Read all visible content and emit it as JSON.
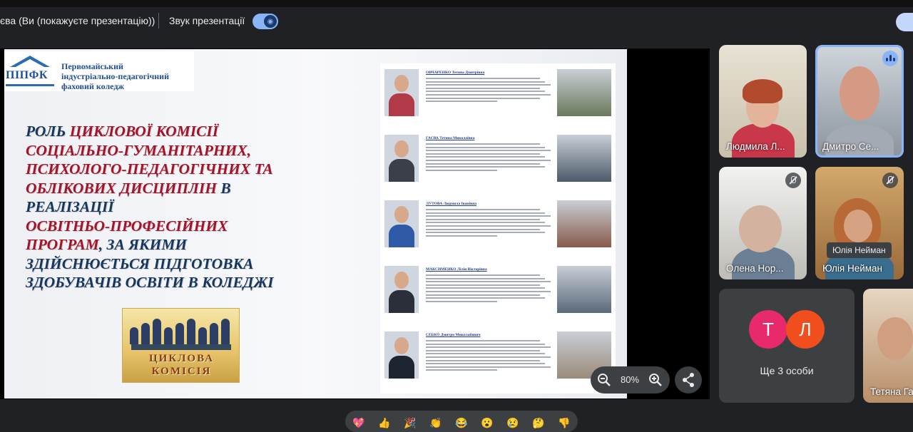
{
  "header": {
    "presenting_label": "єва (Ви (покажуєте презентацію))",
    "sound_label": "Звук презентації",
    "sound_on": true
  },
  "slide": {
    "logo_abbr": "ПІПФК",
    "logo_lines": [
      "Первомайський",
      "індустріально-педагогічний",
      "фаховий коледж"
    ],
    "title_lines": [
      [
        {
          "t": "Роль ",
          "red": false
        },
        {
          "t": "циклової комісії",
          "red": true
        }
      ],
      [
        {
          "t": "соціально-гуманітарних,",
          "red": true
        }
      ],
      [
        {
          "t": "психолого-педагогічних та",
          "red": true
        }
      ],
      [
        {
          "t": "облікових дисциплін",
          "red": true
        },
        {
          "t": " в",
          "red": false
        }
      ],
      [
        {
          "t": "реалізації",
          "red": false
        }
      ],
      [
        {
          "t": "освітньо-професійних",
          "red": true
        }
      ],
      [
        {
          "t": "програм",
          "red": true
        },
        {
          "t": ", за якими",
          "red": false
        }
      ],
      [
        {
          "t": "здійснюється підготовка",
          "red": false
        }
      ],
      [
        {
          "t": "здобувачів освіти в коледжі",
          "red": false
        }
      ]
    ],
    "image_text": [
      "ЦИКЛОВА",
      "КОМІСІЯ"
    ],
    "document": {
      "entries": [
        {
          "name": "ОВЧАРЕНКО Тетяна Дмитрівна",
          "lines": 8,
          "color": "#b23a48"
        },
        {
          "name": "ГАЄВА Тетяна Миколаївна",
          "lines": 9,
          "color": "#3a3f4a"
        },
        {
          "name": "ЛУТОВА Людмила Іванівна",
          "lines": 9,
          "color": "#2f5aa8"
        },
        {
          "name": "МАКСИМЕНКО Лілія Вікторівна",
          "lines": 9,
          "color": "#2a2f3a"
        },
        {
          "name": "СЕБКО Дмитро Миколайович",
          "lines": 10,
          "color": "#1f2530"
        }
      ]
    }
  },
  "zoom": {
    "value": "80%"
  },
  "participants": [
    {
      "name": "Людмила Л...",
      "muted": false,
      "speaking": false
    },
    {
      "name": "Дмитро Се...",
      "muted": false,
      "speaking": true
    },
    {
      "name": "Олена Нор...",
      "muted": true,
      "speaking": false
    },
    {
      "name": "Юлія Нейман",
      "muted": true,
      "speaking": false,
      "tooltip": "Юлія Нейман"
    },
    {
      "name": "Тетяна Га",
      "muted": false,
      "speaking": false
    }
  ],
  "more": {
    "label": "Ще 3 особи",
    "avatars": [
      {
        "letter": "Т",
        "color": "#e8296b"
      },
      {
        "letter": "Л",
        "color": "#f04e1c"
      }
    ]
  },
  "reactions": [
    "💖",
    "👍",
    "🎉",
    "👏",
    "😂",
    "😮",
    "😢",
    "🤔",
    "👎"
  ]
}
